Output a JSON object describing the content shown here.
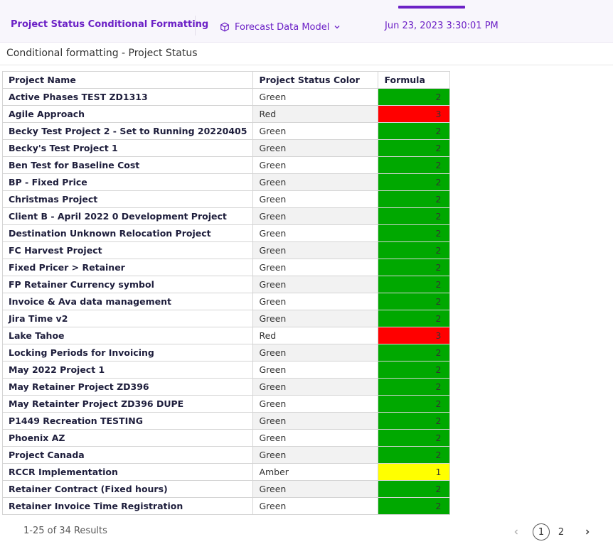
{
  "header": {
    "report_title": "Project Status Conditional Formatting",
    "data_model": "Forecast Data Model",
    "timestamp": "Jun 23, 2023 3:30:01 PM"
  },
  "section": {
    "title": "Conditional formatting - Project Status"
  },
  "table": {
    "columns": [
      "Project Name",
      "Project Status Color",
      "Formula"
    ],
    "status_colors": {
      "Green": "#00a800",
      "Red": "#ff0000",
      "Amber": "#ffff00"
    },
    "rows": [
      {
        "name": "Active Phases TEST ZD1313",
        "status": "Green",
        "formula": "2"
      },
      {
        "name": "Agile Approach",
        "status": "Red",
        "formula": "3"
      },
      {
        "name": "Becky Test Project 2 - Set to Running 20220405",
        "status": "Green",
        "formula": "2"
      },
      {
        "name": "Becky's Test Project 1",
        "status": "Green",
        "formula": "2"
      },
      {
        "name": "Ben Test for Baseline Cost",
        "status": "Green",
        "formula": "2"
      },
      {
        "name": "BP - Fixed Price",
        "status": "Green",
        "formula": "2"
      },
      {
        "name": "Christmas Project",
        "status": "Green",
        "formula": "2"
      },
      {
        "name": "Client B - April 2022 0 Development Project",
        "status": "Green",
        "formula": "2"
      },
      {
        "name": "Destination Unknown Relocation Project",
        "status": "Green",
        "formula": "2"
      },
      {
        "name": "FC Harvest Project",
        "status": "Green",
        "formula": "2"
      },
      {
        "name": "Fixed Pricer > Retainer",
        "status": "Green",
        "formula": "2"
      },
      {
        "name": "FP Retainer Currency symbol",
        "status": "Green",
        "formula": "2"
      },
      {
        "name": "Invoice & Ava data management",
        "status": "Green",
        "formula": "2"
      },
      {
        "name": "Jira Time v2",
        "status": "Green",
        "formula": "2"
      },
      {
        "name": "Lake Tahoe",
        "status": "Red",
        "formula": "3"
      },
      {
        "name": "Locking Periods for Invoicing",
        "status": "Green",
        "formula": "2"
      },
      {
        "name": "May 2022 Project 1",
        "status": "Green",
        "formula": "2"
      },
      {
        "name": "May Retainer Project ZD396",
        "status": "Green",
        "formula": "2"
      },
      {
        "name": "May Retainter Project ZD396 DUPE",
        "status": "Green",
        "formula": "2"
      },
      {
        "name": "P1449 Recreation TESTING",
        "status": "Green",
        "formula": "2"
      },
      {
        "name": "Phoenix AZ",
        "status": "Green",
        "formula": "2"
      },
      {
        "name": "Project Canada",
        "status": "Green",
        "formula": "2"
      },
      {
        "name": "RCCR Implementation",
        "status": "Amber",
        "formula": "1"
      },
      {
        "name": "Retainer Contract (Fixed hours)",
        "status": "Green",
        "formula": "2"
      },
      {
        "name": "Retainer Invoice Time Registration",
        "status": "Green",
        "formula": "2"
      }
    ]
  },
  "footer": {
    "results_text": "1-25 of 34 Results",
    "pages": [
      "1",
      "2"
    ],
    "current_page": "1"
  },
  "icons": {
    "model": "cube-icon",
    "dropdown": "chevron-down-icon",
    "prev": "chevron-left-icon",
    "next": "chevron-right-icon"
  },
  "colors": {
    "accent": "#6c21c6"
  }
}
